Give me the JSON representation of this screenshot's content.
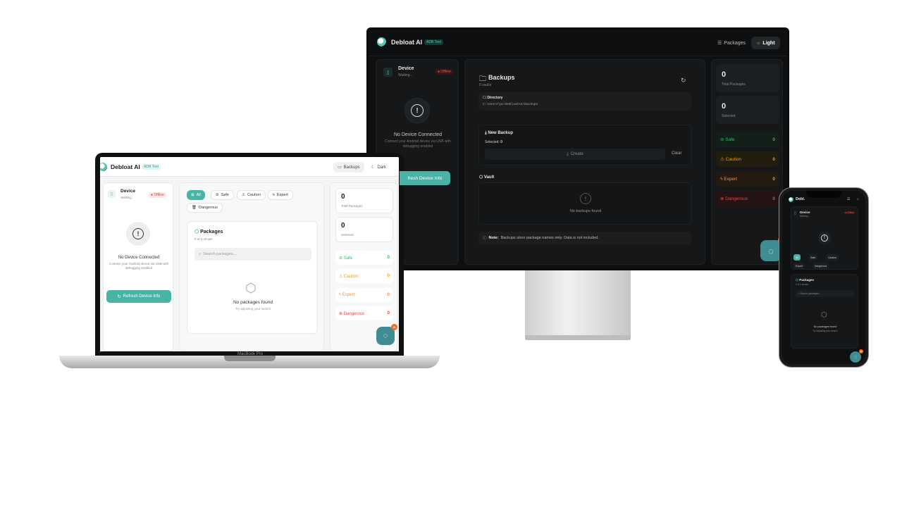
{
  "colors": {
    "accent": "#49b3a6",
    "safe": "#22c55e",
    "caution": "#f59e0b",
    "expert": "#fb923c",
    "dangerous": "#ef4444",
    "offline": "#e35a5a"
  },
  "app": {
    "name": "Debloat AI",
    "tag": "ADB Tool",
    "phone_name": "Debl."
  },
  "nav": {
    "packages": "Packages",
    "light": "Light",
    "dark": "Dark",
    "backups": "Backups"
  },
  "device": {
    "title": "Device",
    "status": "Waiting...",
    "badge": "Offline",
    "none_title": "No Device Connected",
    "none_desc": "Connect your Android device via USB with debugging enabled",
    "refresh": "Refresh Device Info",
    "refresh_partial": "fresh Device Info"
  },
  "filters": {
    "all": "All",
    "safe": "Safe",
    "caution": "Caution",
    "expert": "Expert",
    "dangerous": "Dangerous"
  },
  "packages": {
    "title": "Packages",
    "shown": "0 of 0 shown",
    "search_placeholder": "Search packages...",
    "empty_title": "No packages found",
    "empty_desc": "Try adjusting your search"
  },
  "stats": {
    "total": "0",
    "total_label": "Total Packages",
    "selected": "0",
    "selected_label": "Selected",
    "safe": "Safe",
    "safe_n": "0",
    "caution": "Caution",
    "caution_n": "0",
    "expert": "Expert",
    "expert_n": "0",
    "dangerous": "Dangerous",
    "dangerous_n": "0"
  },
  "backups": {
    "title": "Backups",
    "count": "0 vaults",
    "dir_label": "Directory",
    "dir_path": "C:\\Users\\pc\\DebloatAI\\backups",
    "new_label": "New Backup",
    "selected_prefix": "Selected:",
    "selected_n": "0",
    "create": "Create",
    "clear": "Clear",
    "vault": "Vault",
    "vault_empty": "No backups found",
    "note_bold": "Note:",
    "note_text": "Backups store package names only. Data is not included."
  },
  "chat": {
    "ai": "AI"
  },
  "device_label": "MacBook Pro"
}
